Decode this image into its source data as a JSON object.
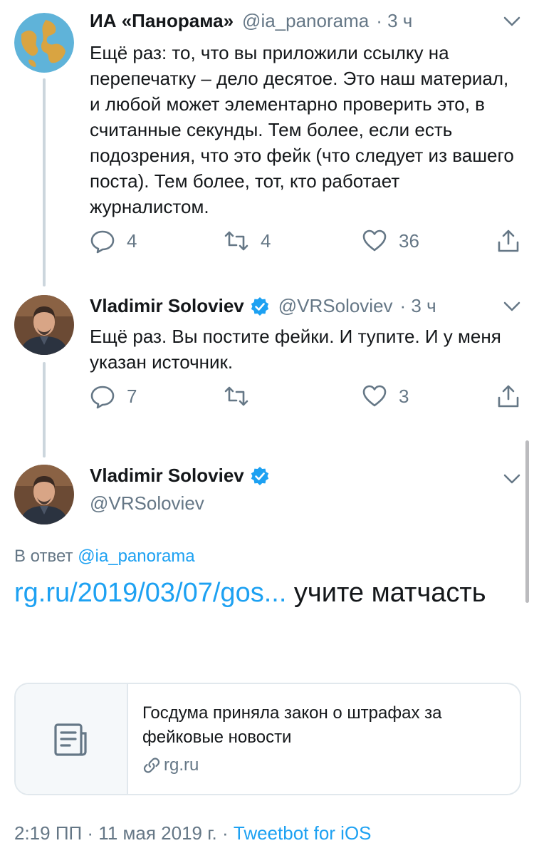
{
  "tweets": [
    {
      "name": "ИА «Панорама»",
      "handle": "@ia_panorama",
      "time": "· 3 ч",
      "text": "Ещё раз: то, что вы приложили ссылку на перепечатку – дело десятое. Это наш материал, и любой может элементарно проверить это, в считанные секунды. Тем более, если есть подозрения, что это фейк (что следует из вашего поста). Тем более, тот, кто работает журналистом.",
      "replies": "4",
      "retweets": "4",
      "likes": "36",
      "avatar_icon": "globe-icon"
    },
    {
      "name": "Vladimir Soloviev",
      "handle": "@VRSoloviev",
      "time": "· 3 ч",
      "text": "Ещё раз. Вы постите фейки. И тупите. И у меня указан источник.",
      "replies": "7",
      "retweets": "",
      "likes": "3",
      "avatar_icon": "user-photo"
    }
  ],
  "main": {
    "name": "Vladimir Soloviev",
    "handle": "@VRSoloviev",
    "reply_prefix": "В ответ",
    "reply_mention": "@ia_panorama",
    "link": "rg.ru/2019/03/07/gos...",
    "text_rest": " учите матчасть",
    "card": {
      "title": "Госдума приняла закон о штрафах за фейковые новости",
      "domain": "rg.ru"
    },
    "timestamp": "2:19 ПП · 11 мая 2019 г. · ",
    "client": "Tweetbot for iOS"
  },
  "colors": {
    "link": "#1da1f2",
    "muted": "#657786",
    "verified": "#1da1f2",
    "thread_line": "#ccd6dd"
  }
}
